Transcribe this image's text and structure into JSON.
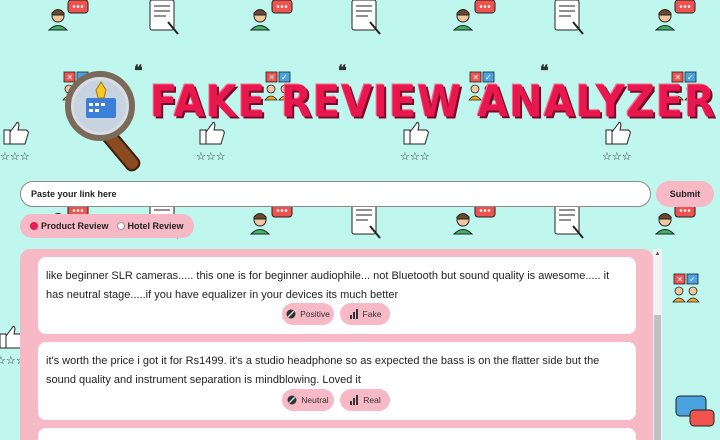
{
  "app": {
    "title": "FAKE REVIEW ANALYZER"
  },
  "search": {
    "placeholder": "Paste your link here",
    "value": "",
    "submit_label": "Submit"
  },
  "review_type": {
    "options": [
      {
        "label": "Product Review",
        "selected": true
      },
      {
        "label": "Hotel Review",
        "selected": false
      }
    ]
  },
  "reviews": [
    {
      "text": "like beginner SLR cameras..... this one is for beginner audiophile... not Bluetooth but sound quality is awesome..... it has neutral stage.....if you have equalizer in your devices its much better",
      "sentiment": "Positive",
      "verdict": "Fake"
    },
    {
      "text": "it's worth the price i got it for Rs1499. it's a studio headphone so as expected the bass is on the flatter side but the sound quality and instrument separation is mindblowing. Loved it",
      "sentiment": "Neutral",
      "verdict": "Real"
    }
  ],
  "colors": {
    "background": "#bff7ee",
    "accent_pink": "#f7b9c6",
    "title_red": "#e8184f"
  },
  "icons": {
    "sentiment": "sentiment-icon",
    "verdict": "bar-chart-icon",
    "logo": "magnifier-icon"
  }
}
